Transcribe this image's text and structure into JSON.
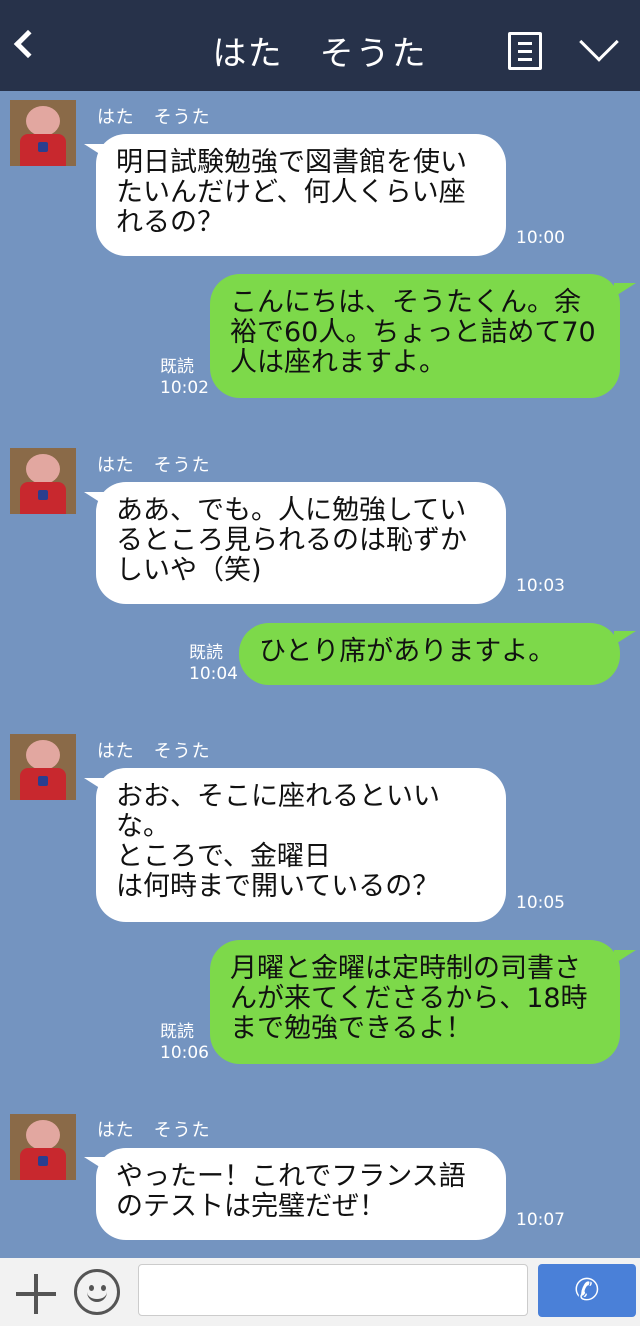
{
  "header": {
    "title": "はた　そうた",
    "back_icon": "chevron-left-icon",
    "menu_icon": "menu-list-icon",
    "collapse_icon": "chevron-down-icon"
  },
  "messages": [
    {
      "direction": "in",
      "sender": "はた　そうた",
      "text": "明日試験勉強で図書館を使いたいんだけど、何人くらい座れるの？",
      "time": "10:00"
    },
    {
      "direction": "out",
      "text": "こんにちは、そうたくん。余裕で60人。ちょっと詰めて70人は座れますよ。",
      "read": "既読",
      "time": "10:02"
    },
    {
      "direction": "in",
      "sender": "はた　そうた",
      "text": "ああ、でも。人に勉強しているところ見られるのは恥ずかしいや（笑)",
      "time": "10:03"
    },
    {
      "direction": "out",
      "text": "ひとり席がありますよ。",
      "read": "既読",
      "time": "10:04"
    },
    {
      "direction": "in",
      "sender": "はた　そうた",
      "text": "おお、そこに座れるといいな。\nところで、金曜日\nは何時まで開いているの？",
      "time": "10:05"
    },
    {
      "direction": "out",
      "text": "月曜と金曜は定時制の司書さんが来てくださるから、18時まで勉強できるよ！",
      "read": "既読",
      "time": "10:06"
    },
    {
      "direction": "in",
      "sender": "はた　そうた",
      "text": "やったー！これでフランス語のテストは完璧だぜ！",
      "time": "10:07"
    }
  ],
  "input_bar": {
    "add_icon": "plus-icon",
    "emoji_icon": "smile-icon",
    "input_value": "",
    "send_icon": "phone-icon",
    "send_glyph": "✆"
  },
  "colors": {
    "background": "#7494c0",
    "header": "#27324a",
    "incoming_bubble": "#ffffff",
    "outgoing_bubble": "#7dd94a",
    "send_button": "#4a80d8"
  }
}
